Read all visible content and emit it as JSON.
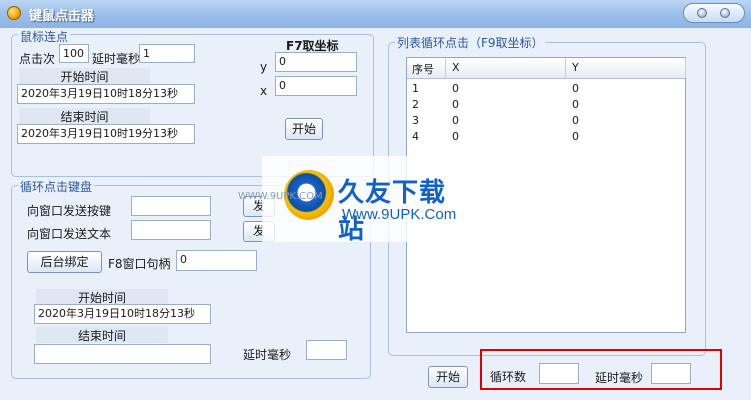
{
  "window": {
    "title": "键鼠点击器"
  },
  "mouse": {
    "legend": "鼠标连点",
    "click_count_label": "点击次",
    "click_count_value": "100",
    "delay_label": "延时毫秒",
    "delay_value": "1",
    "start_time_label": "开始时间",
    "start_time_value": "2020年3月19日10时18分13秒",
    "end_time_label": "结束时间",
    "end_time_value": "2020年3月19日10时19分13秒",
    "coord_label": "F7取坐标",
    "y_label": "y",
    "y_value": "0",
    "x_label": "x",
    "x_value": "0",
    "start_button": "开始"
  },
  "keyboard": {
    "legend": "循环点击键盘",
    "send_key_label": "向窗口发送按键",
    "send_key_value": "",
    "send_key_button": "发",
    "send_text_label": "向窗口发送文本",
    "send_text_value": "",
    "send_text_button": "发",
    "bind_button": "后台绑定",
    "handle_label": "F8窗口句柄",
    "handle_value": "0",
    "start_time_label": "开始时间",
    "start_time_value": "2020年3月19日10时18分13秒",
    "end_time_label": "结束时间",
    "end_time_value": "",
    "delay_label": "延时毫秒",
    "delay_value": ""
  },
  "list_panel": {
    "legend": "列表循环点击（F9取坐标）",
    "columns": [
      "序号",
      "X",
      "Y"
    ],
    "rows": [
      [
        "1",
        "0",
        "0"
      ],
      [
        "2",
        "0",
        "0"
      ],
      [
        "3",
        "0",
        "0"
      ],
      [
        "4",
        "0",
        "0"
      ]
    ]
  },
  "bottom": {
    "start_button": "开始",
    "loop_count_label": "循环数",
    "loop_count_value": "",
    "delay_label": "延时毫秒",
    "delay_value": ""
  },
  "watermark": {
    "brand": "久友下载站",
    "url": "Www.9UPK.Com",
    "overlay_url": "WWW.9UPK.COM",
    "colors": {
      "brand": "#1261c9",
      "logo_ring": "#f0a000"
    }
  },
  "colors": {
    "highlight_box": "#e00000",
    "legend_text": "#2e57a0",
    "titlebar": "#9bbfe9"
  }
}
